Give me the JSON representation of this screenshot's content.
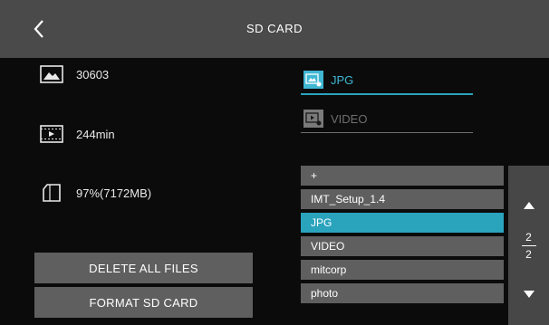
{
  "header": {
    "title": "SD CARD",
    "back_icon": "chevron-left-icon"
  },
  "stats": {
    "photos": {
      "icon": "image-icon",
      "value": "30603"
    },
    "video": {
      "icon": "film-icon",
      "value": "244min"
    },
    "storage": {
      "icon": "sd-card-icon",
      "value": "97%(7172MB)"
    }
  },
  "actions": {
    "delete_label": "DELETE ALL FILES",
    "format_label": "FORMAT SD CARD"
  },
  "modes": [
    {
      "label": "JPG",
      "icon": "image-download-icon",
      "active": true
    },
    {
      "label": "VIDEO",
      "icon": "video-download-icon",
      "active": false
    }
  ],
  "files": [
    {
      "label": "+"
    },
    {
      "label": "IMT_Setup_1.4"
    },
    {
      "label": "JPG",
      "selected": true
    },
    {
      "label": "VIDEO"
    },
    {
      "label": "mitcorp"
    },
    {
      "label": "photo"
    }
  ],
  "pager": {
    "current": "2",
    "total": "2",
    "up_icon": "triangle-up-icon",
    "down_icon": "triangle-down-icon"
  },
  "colors": {
    "accent": "#2aa3bd",
    "accent_text": "#3fb7d3",
    "header_bg": "#4a4a4a",
    "button_bg": "#5f5f5f",
    "background": "#0b0b0b"
  }
}
